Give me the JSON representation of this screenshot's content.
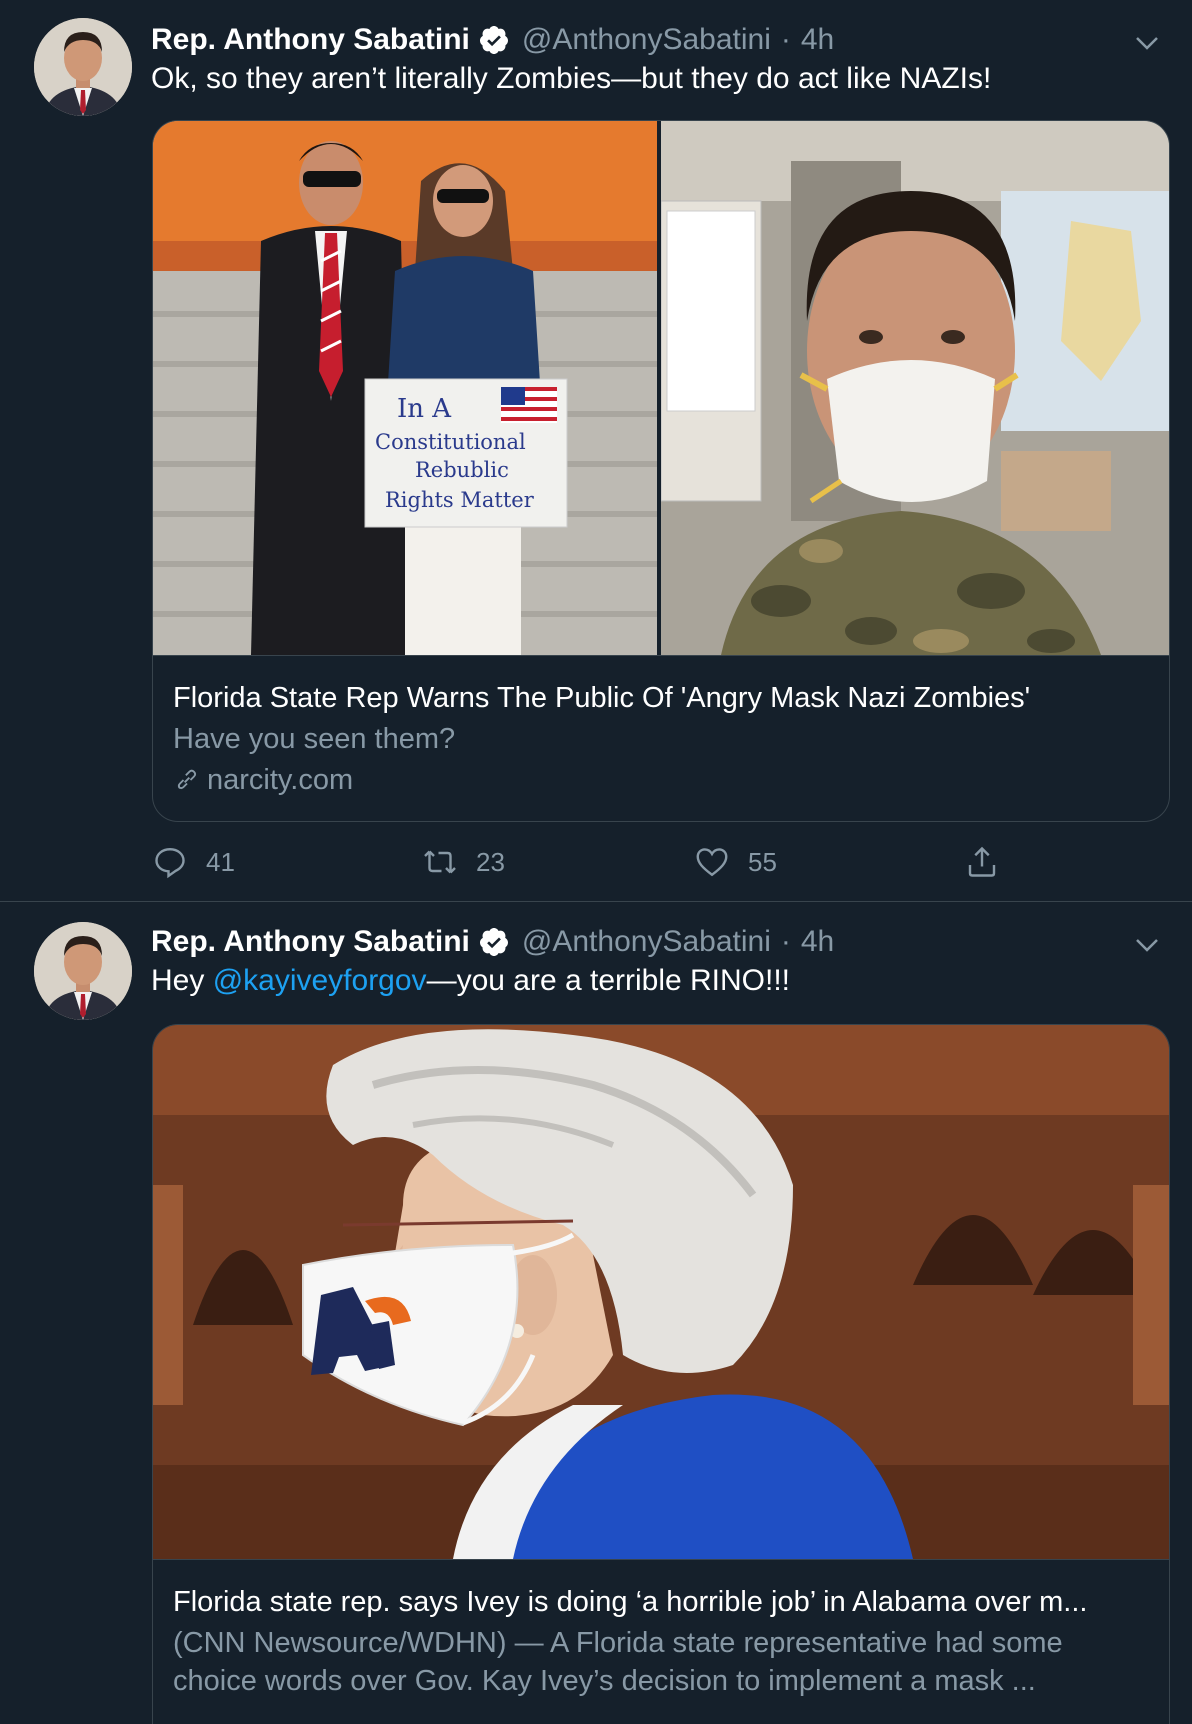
{
  "tweets": [
    {
      "author_name": "Rep. Anthony Sabatini",
      "handle": "@AnthonySabatini",
      "separator": "·",
      "time": "4h",
      "text": "Ok, so they aren’t literally Zombies—but they do act like NAZIs!",
      "card": {
        "title": "Florida State Rep Warns The Public Of 'Angry Mask Nazi Zombies'",
        "description": "Have you seen them?",
        "domain": "narcity.com",
        "sign_text": [
          "In A",
          "Constitutional",
          "Rebublic",
          "Rights Matter"
        ]
      },
      "actions": {
        "replies": "41",
        "retweets": "23",
        "likes": "55"
      }
    },
    {
      "author_name": "Rep. Anthony Sabatini",
      "handle": "@AnthonySabatini",
      "separator": "·",
      "time": "4h",
      "text_before": "Hey ",
      "mention": "@kayiveyforgov",
      "text_after": "—you are a terrible RINO!!!",
      "card": {
        "title": "Florida state rep. says Ivey is doing ‘a horrible job’ in Alabama over m...",
        "description": "(CNN Newsource/WDHN) — A Florida state representative had some choice words over Gov. Kay Ivey’s decision to implement a mask ..."
      }
    }
  ],
  "colors": {
    "background": "#15202b",
    "border": "#38444d",
    "secondary_text": "#8899a6",
    "link": "#1da1f2"
  },
  "icons": [
    "verified-badge-icon",
    "chevron-down-icon",
    "reply-icon",
    "retweet-icon",
    "like-icon",
    "share-icon",
    "link-icon"
  ]
}
